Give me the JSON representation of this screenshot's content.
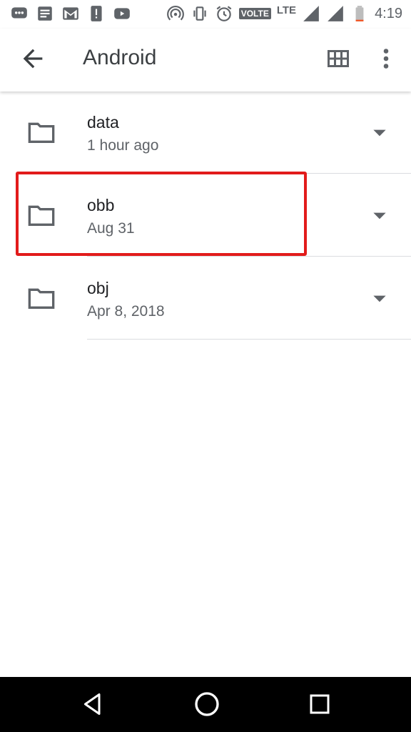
{
  "statusbar": {
    "time": "4:19",
    "volte": "VOLTE",
    "lte": "LTE",
    "icons_left": [
      "messaging-icon",
      "notes-icon",
      "gmail-icon",
      "alert-icon",
      "youtube-icon"
    ],
    "icons_right": [
      "hotspot-icon",
      "vibrate-icon",
      "alarm-icon",
      "signal-icon",
      "battery-icon"
    ]
  },
  "appbar": {
    "title": "Android"
  },
  "files": [
    {
      "name": "data",
      "date": "1 hour ago"
    },
    {
      "name": "obb",
      "date": "Aug 31"
    },
    {
      "name": "obj",
      "date": "Apr 8, 2018"
    }
  ],
  "colors": {
    "highlight": "#e21b1b",
    "icon": "#5f6368",
    "text": "#202124"
  }
}
